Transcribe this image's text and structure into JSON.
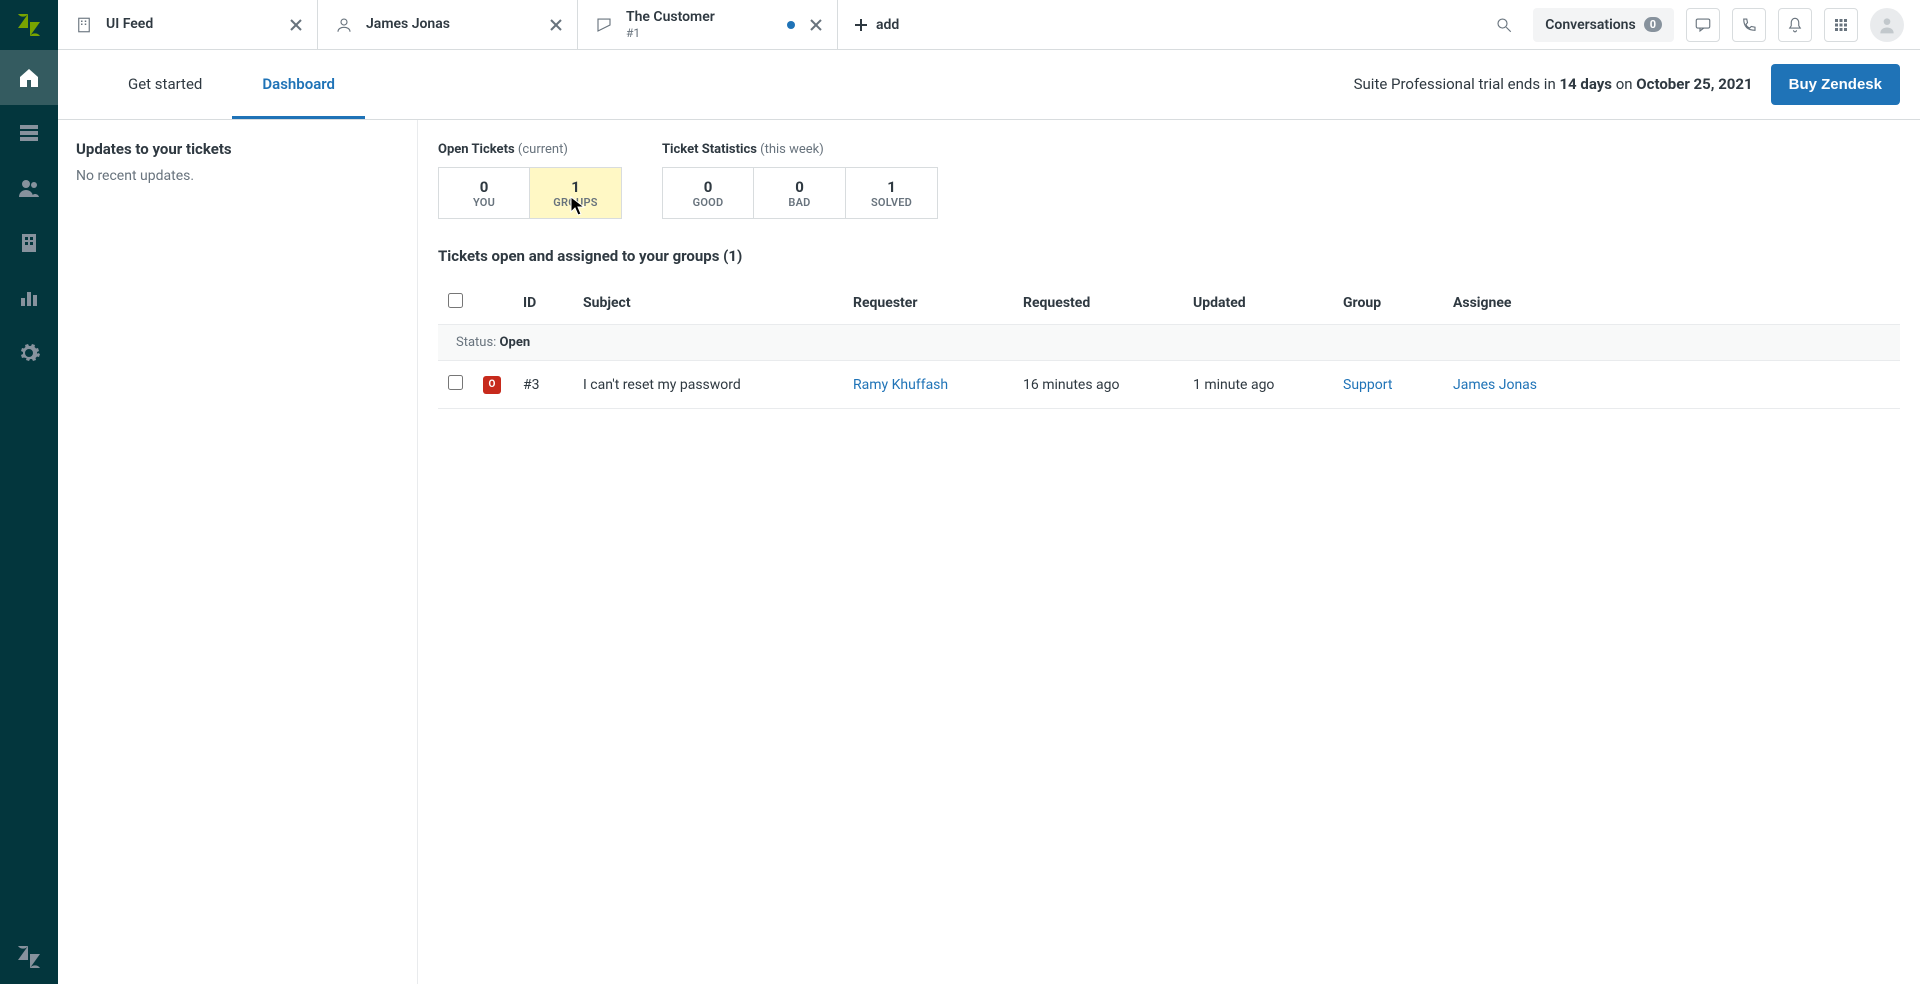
{
  "tabs": [
    {
      "title": "UI Feed",
      "sub": "",
      "icon": "building"
    },
    {
      "title": "James Jonas",
      "sub": "",
      "icon": "user"
    },
    {
      "title": "The Customer",
      "sub": "#1",
      "icon": "ticket",
      "dot": true
    }
  ],
  "add_label": "add",
  "conversations": {
    "label": "Conversations",
    "badge": "0"
  },
  "banner": {
    "tabs": [
      "Get started",
      "Dashboard"
    ],
    "active_index": 1,
    "trial_prefix": "Suite Professional trial ends in ",
    "trial_days": "14 days",
    "trial_mid": " on ",
    "trial_date": "October 25, 2021",
    "buy_label": "Buy Zendesk"
  },
  "updates": {
    "heading": "Updates to your tickets",
    "body": "No recent updates."
  },
  "stats": {
    "open": {
      "label": "Open Tickets",
      "sublabel": "(current)",
      "boxes": [
        {
          "num": "0",
          "lbl": "YOU"
        },
        {
          "num": "1",
          "lbl": "GROUPS",
          "highlight": true
        }
      ]
    },
    "ticket_stats": {
      "label": "Ticket Statistics",
      "sublabel": "(this week)",
      "boxes": [
        {
          "num": "0",
          "lbl": "GOOD"
        },
        {
          "num": "0",
          "lbl": "BAD"
        },
        {
          "num": "1",
          "lbl": "SOLVED"
        }
      ]
    }
  },
  "section_title": "Tickets open and assigned to your groups (1)",
  "table": {
    "headers": [
      "",
      "",
      "ID",
      "Subject",
      "Requester",
      "Requested",
      "Updated",
      "Group",
      "Assignee"
    ],
    "status_label": "Status: ",
    "status_value": "Open",
    "rows": [
      {
        "badge": "O",
        "id": "#3",
        "subject": "I can't reset my password",
        "requester": "Ramy Khuffash",
        "requested": "16 minutes ago",
        "updated": "1 minute ago",
        "group": "Support",
        "assignee": "James Jonas"
      }
    ]
  }
}
